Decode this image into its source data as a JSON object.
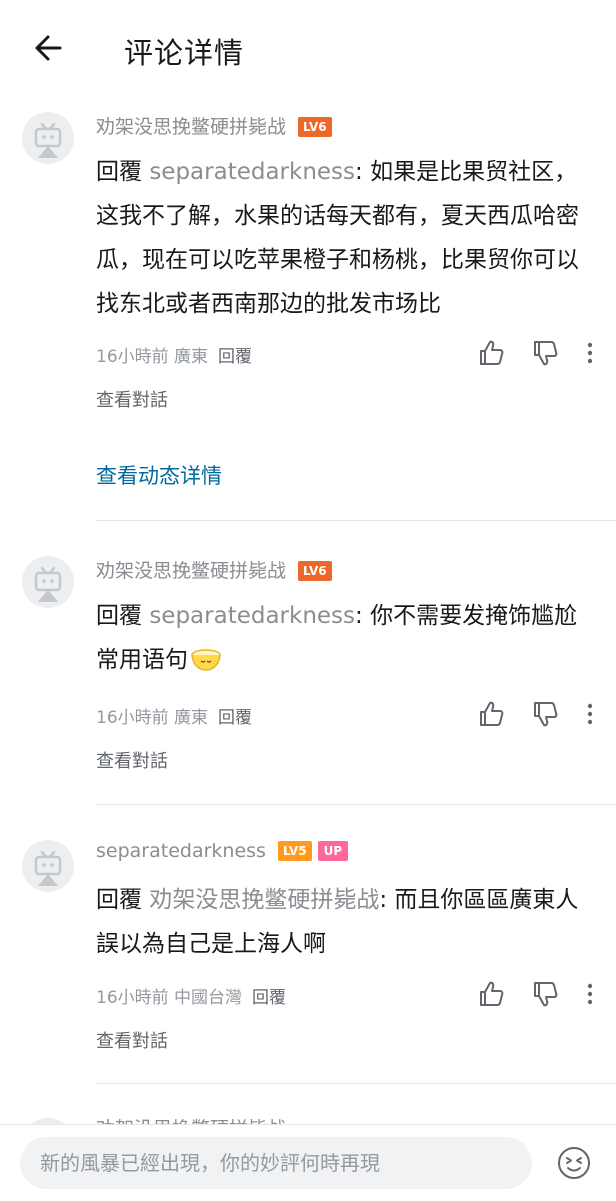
{
  "header": {
    "title": "评论详情"
  },
  "comments": [
    {
      "user": "劝架没思挽鳖硬拼毙战",
      "level": "LV6",
      "up": "",
      "reply_prefix": "回覆 ",
      "mention": "separatedarkness",
      "text": ": 如果是比果贸社区，这我不了解，水果的话每天都有，夏天西瓜哈密瓜，现在可以吃苹果橙子和杨桃，比果贸你可以找东北或者西南那边的批发市场比",
      "time": "16小時前",
      "location": "廣東",
      "reply_label": "回覆",
      "view_conversation": "查看對話"
    },
    {
      "user": "劝架没思挽鳖硬拼毙战",
      "level": "LV6",
      "up": "",
      "reply_prefix": "回覆 ",
      "mention": "separatedarkness",
      "text": ": 你不需要发掩饰尴尬常用语句",
      "time": "16小時前",
      "location": "廣東",
      "reply_label": "回覆",
      "view_conversation": "查看對話"
    },
    {
      "user": "separatedarkness",
      "level": "LV5",
      "up": "UP",
      "reply_prefix": "回覆 ",
      "mention": "劝架没思挽鳖硬拼毙战",
      "text": ": 而且你區區廣東人誤以為自己是上海人啊",
      "time": "16小時前",
      "location": "中國台灣",
      "reply_label": "回覆",
      "view_conversation": "查看對話"
    }
  ],
  "view_dynamic_detail": "查看动态详情",
  "partial_next_user": "劝架没思挽鳖硬拼毙战",
  "input": {
    "placeholder": "新的風暴已經出現，你的妙評何時再現"
  },
  "icons": {
    "back": "arrow-left-icon",
    "like": "thumbs-up-icon",
    "dislike": "thumbs-down-icon",
    "more": "more-vertical-icon",
    "emoji": "emoji-face-icon",
    "avatar": "default-tv-avatar-icon"
  },
  "colors": {
    "link": "#00699d",
    "lv6": "#ee672a",
    "lv5": "#ff9a1f",
    "up": "#ff6699",
    "muted": "#9499a0"
  }
}
